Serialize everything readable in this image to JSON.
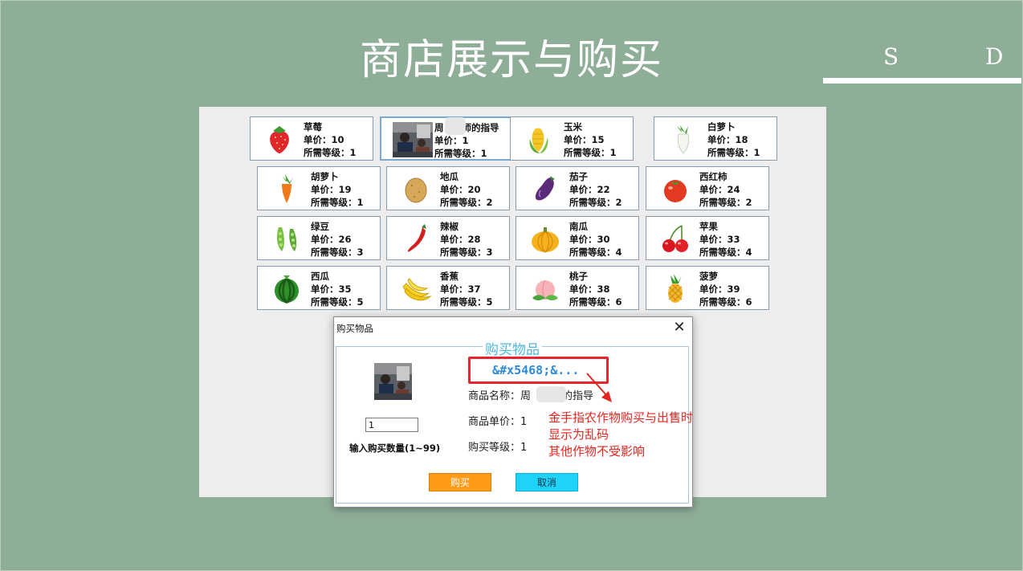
{
  "slide": {
    "title": "商店展示与购买",
    "brand_s": "S",
    "brand_d": "D"
  },
  "shop": {
    "price_prefix": "单价：",
    "level_prefix": "所需等级：",
    "items": [
      {
        "name": "草莓",
        "price": "10",
        "level": "1",
        "icon": "strawberry-icon"
      },
      {
        "name": "周　　师的指导",
        "price": "1",
        "level": "1",
        "icon": "teacher-photo"
      },
      {
        "name": "玉米",
        "price": "15",
        "level": "1",
        "icon": "corn-icon"
      },
      {
        "name": "白萝卜",
        "price": "18",
        "level": "1",
        "icon": "white-radish-icon"
      },
      {
        "name": "胡萝卜",
        "price": "19",
        "level": "1",
        "icon": "carrot-icon"
      },
      {
        "name": "地瓜",
        "price": "20",
        "level": "2",
        "icon": "sweet-potato-icon"
      },
      {
        "name": "茄子",
        "price": "22",
        "level": "2",
        "icon": "eggplant-icon"
      },
      {
        "name": "西红柿",
        "price": "24",
        "level": "2",
        "icon": "tomato-icon"
      },
      {
        "name": "绿豆",
        "price": "26",
        "level": "3",
        "icon": "mung-bean-icon"
      },
      {
        "name": "辣椒",
        "price": "28",
        "level": "3",
        "icon": "chili-icon"
      },
      {
        "name": "南瓜",
        "price": "30",
        "level": "4",
        "icon": "pumpkin-icon"
      },
      {
        "name": "苹果",
        "price": "33",
        "level": "4",
        "icon": "cherry-icon"
      },
      {
        "name": "西瓜",
        "price": "35",
        "level": "5",
        "icon": "watermelon-icon"
      },
      {
        "name": "香蕉",
        "price": "37",
        "level": "5",
        "icon": "banana-icon"
      },
      {
        "name": "桃子",
        "price": "38",
        "level": "6",
        "icon": "peach-icon"
      },
      {
        "name": "菠萝",
        "price": "39",
        "level": "6",
        "icon": "pineapple-icon"
      }
    ]
  },
  "dialog": {
    "title": "购买物品",
    "group_title": "购买物品",
    "garbled_text": "&#x5468;&...",
    "product_name_label": "商品名称：",
    "product_name_value": "周　　师的指导",
    "unit_price_label": "商品单价：",
    "unit_price_value": "1",
    "level_label": "购买等级：",
    "level_value": "1",
    "quantity_value": "1",
    "quantity_label": "输入购买数量(1~99)",
    "buy_label": "购买",
    "cancel_label": "取消"
  },
  "annotation": {
    "line1": "金手指农作物购买与出售时",
    "line2": "显示为乱码",
    "line3": "其他作物不受影响"
  },
  "colors": {
    "background": "#8fae98",
    "buy": "#ff9b17",
    "cancel": "#1ed3f7",
    "annotation": "#e5251f",
    "legend": "#4fb9df"
  }
}
